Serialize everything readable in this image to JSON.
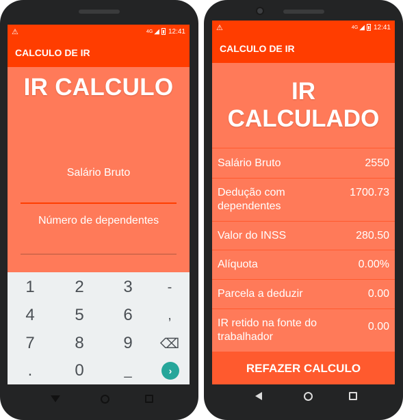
{
  "status_time": "12:41",
  "status_network": "4G",
  "app_title": "CALCULO DE IR",
  "input_screen": {
    "title": "IR CALCULO",
    "salario_label": "Salário Bruto",
    "salario_value": "",
    "dependentes_label": "Número de dependentes",
    "dependentes_value": ""
  },
  "keypad": {
    "keys": [
      "1",
      "2",
      "3",
      "-",
      "4",
      "5",
      "6",
      ",",
      "7",
      "8",
      "9",
      "⌫",
      ".",
      "0",
      "_",
      "›"
    ]
  },
  "result_screen": {
    "title_line1": "IR",
    "title_line2": "CALCULADO",
    "rows": [
      {
        "label": "Salário Bruto",
        "value": "2550"
      },
      {
        "label": "Dedução com dependentes",
        "value": "1700.73"
      },
      {
        "label": "Valor do INSS",
        "value": "280.50"
      },
      {
        "label": "Alíquota",
        "value": "0.00%"
      },
      {
        "label": "Parcela a deduzir",
        "value": "0.00"
      },
      {
        "label": "IR retido na fonte do trabalhador",
        "value": "0.00"
      }
    ],
    "button_label": "REFAZER CALCULO"
  },
  "icons": {
    "warning": "warning-icon",
    "back": "back-icon",
    "home": "home-icon",
    "recent": "recent-apps-icon"
  },
  "colors": {
    "accent": "#ff3d00",
    "panel": "#ff7a59",
    "keypad_bg": "#edf0f1",
    "go_key": "#26a69a"
  }
}
